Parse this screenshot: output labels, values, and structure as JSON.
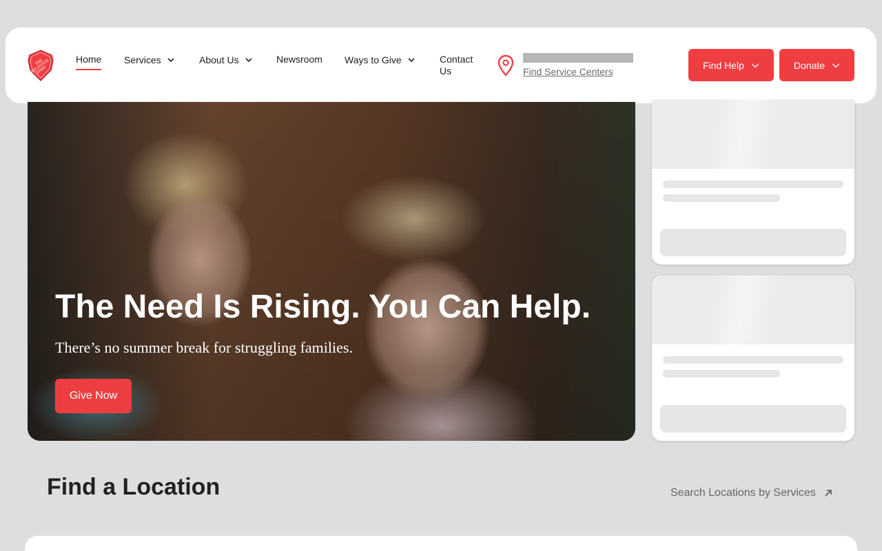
{
  "header": {
    "logo_alt": "The Salvation Army",
    "nav": {
      "home": "Home",
      "services": "Services",
      "about": "About Us",
      "newsroom": "Newsroom",
      "ways_to_give": "Ways to Give",
      "contact": "Contact Us"
    },
    "location_link": "Find Service Centers",
    "find_help": "Find Help",
    "donate": "Donate"
  },
  "hero": {
    "title": "The Need Is Rising. You Can Help.",
    "subtitle": "There’s no summer break for struggling families.",
    "button": "Give Now"
  },
  "find_location": {
    "title": "Find a Location",
    "link": "Search Locations by Services"
  },
  "colors": {
    "accent": "#ef3e42",
    "background": "#dedede"
  },
  "icons": [
    "salvation-army-shield-logo",
    "chevron-down-icon",
    "map-pin-icon",
    "arrow-up-right-icon"
  ]
}
